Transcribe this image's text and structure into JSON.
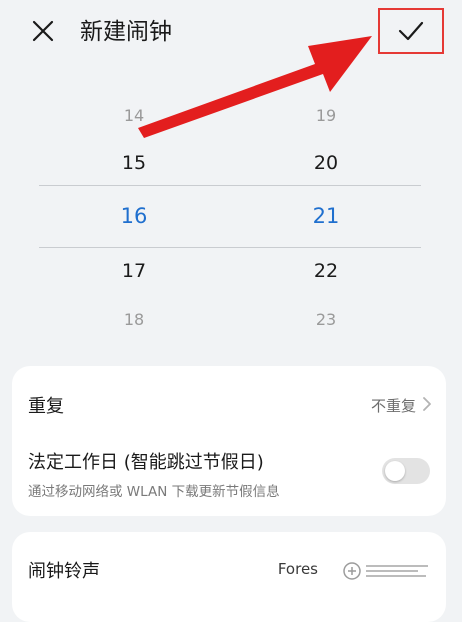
{
  "header": {
    "title": "新建闹钟",
    "close_icon": "close-icon",
    "confirm_icon": "check-icon"
  },
  "picker": {
    "hours": [
      "14",
      "15",
      "16",
      "17",
      "18"
    ],
    "minutes": [
      "19",
      "20",
      "21",
      "22",
      "23"
    ],
    "selected_hour": "16",
    "selected_minute": "21"
  },
  "settings": {
    "repeat": {
      "label": "重复",
      "value": "不重复"
    },
    "workday": {
      "label": "法定工作日 (智能跳过节假日)",
      "sub": "通过移动网络或 WLAN 下载更新节假信息",
      "enabled": false
    },
    "ringtone": {
      "label": "闹钟铃声",
      "value": "Fores"
    }
  },
  "colors": {
    "accent": "#1f6fce",
    "annotation": "#e53935",
    "background": "#f1f3f5"
  }
}
